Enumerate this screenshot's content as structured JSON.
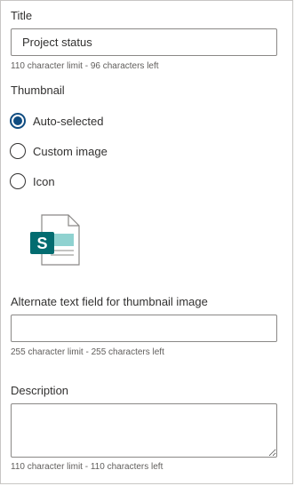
{
  "title_section": {
    "label": "Title",
    "value": "Project status",
    "hint": "110 character limit - 96 characters left"
  },
  "thumbnail_section": {
    "label": "Thumbnail",
    "options": [
      {
        "label": "Auto-selected",
        "checked": true
      },
      {
        "label": "Custom image",
        "checked": false
      },
      {
        "label": "Icon",
        "checked": false
      }
    ],
    "preview_icon": "sharepoint-file-icon",
    "preview_icon_letter": "S"
  },
  "alt_text_section": {
    "label": "Alternate text field for thumbnail image",
    "value": "",
    "hint": "255 character limit - 255 characters left"
  },
  "description_section": {
    "label": "Description",
    "value": "",
    "hint": "110 character limit - 110 characters left"
  },
  "colors": {
    "accent": "#0f4c81",
    "sharepoint_teal": "#036c70",
    "sharepoint_light_teal": "#8fd2d0"
  }
}
